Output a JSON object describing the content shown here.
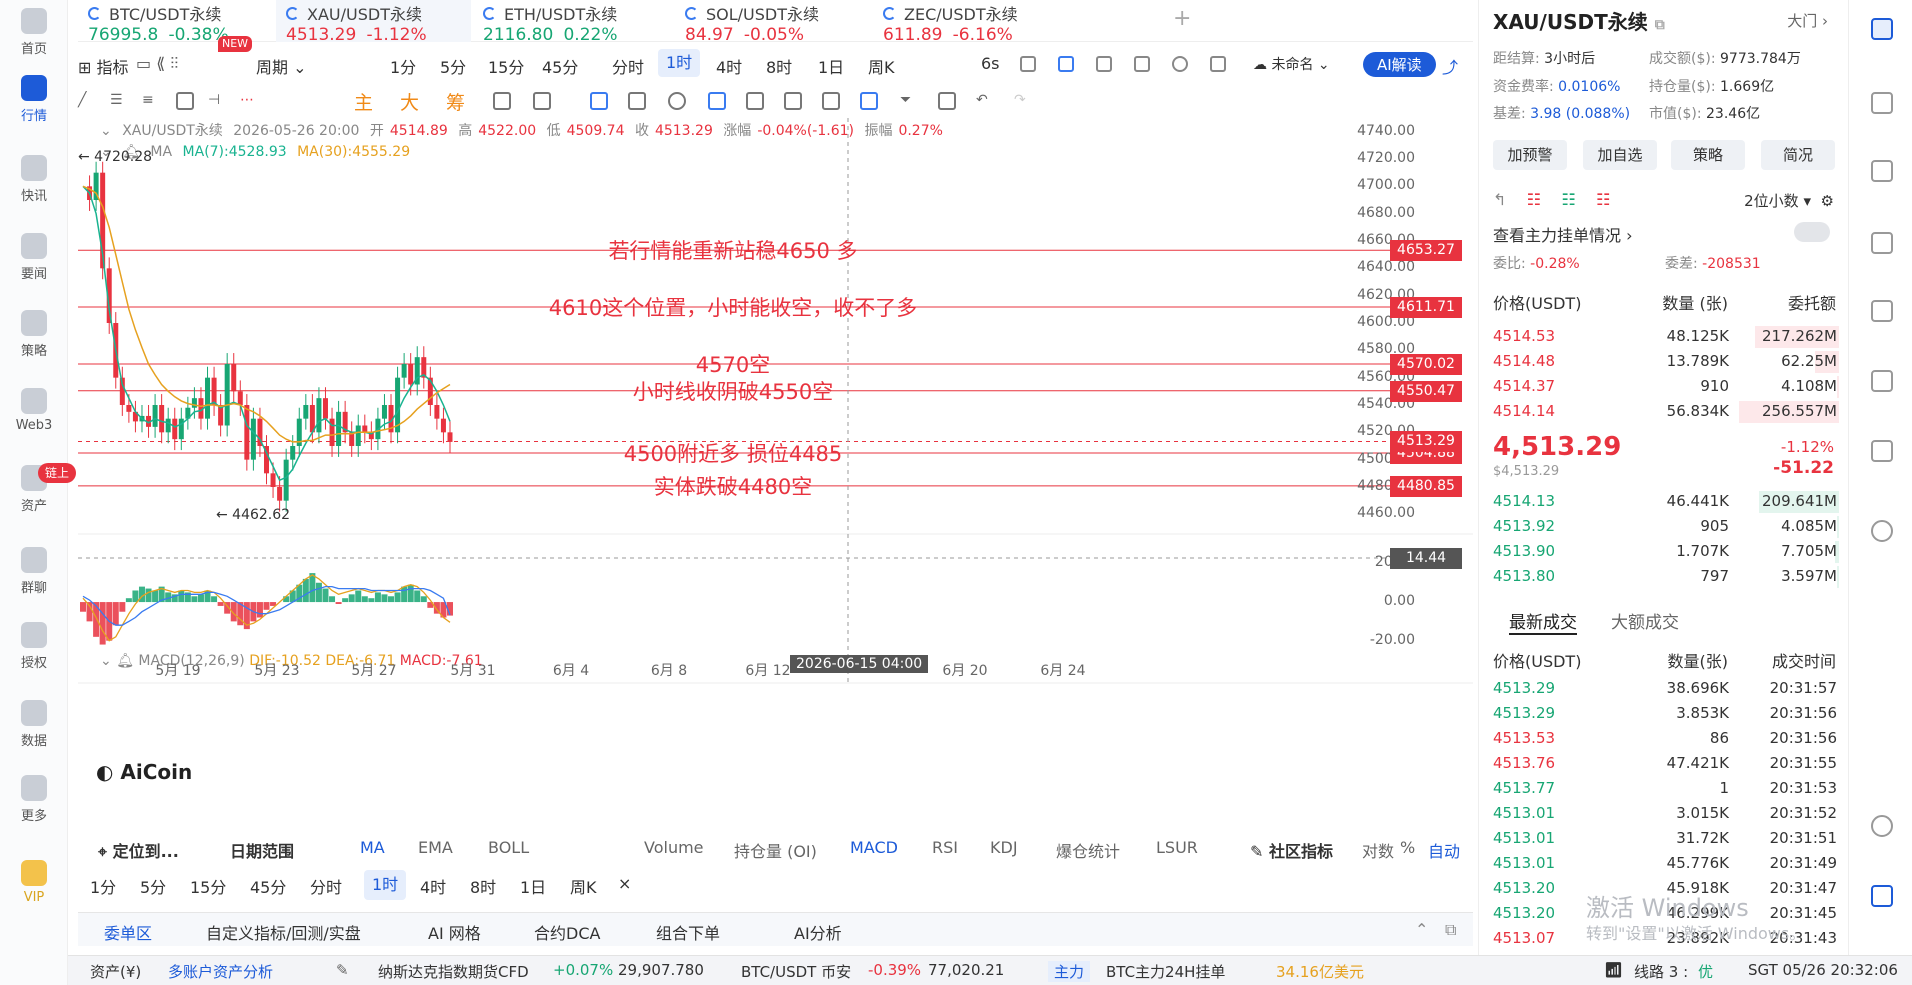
{
  "nav": [
    {
      "label": "首页",
      "icon": "home-icon"
    },
    {
      "label": "行情",
      "icon": "market-chart-icon",
      "active": true
    },
    {
      "label": "快讯",
      "icon": "news-flash-icon"
    },
    {
      "label": "要闻",
      "icon": "headline-icon"
    },
    {
      "label": "策略",
      "icon": "strategy-icon"
    },
    {
      "label": "Web3",
      "icon": "web3-icon"
    },
    {
      "label": "资产",
      "icon": "wallet-icon"
    },
    {
      "label": "群聊",
      "icon": "chat-icon"
    },
    {
      "label": "授权",
      "icon": "authorize-icon"
    },
    {
      "label": "数据",
      "icon": "data-icon"
    },
    {
      "label": "更多",
      "icon": "more-icon"
    },
    {
      "label": "VIP",
      "icon": "vip-icon"
    }
  ],
  "nav_badge": "链上",
  "tickers": [
    {
      "name": "BTC/USDT永续",
      "price": "76995.8",
      "change": "-0.38%",
      "color": "green"
    },
    {
      "name": "XAU/USDT永续",
      "price": "4513.29",
      "change": "-1.12%",
      "color": "red",
      "active": true
    },
    {
      "name": "ETH/USDT永续",
      "price": "2116.80",
      "change": "0.22%",
      "color": "green"
    },
    {
      "name": "SOL/USDT永续",
      "price": "84.97",
      "change": "-0.05%",
      "color": "red"
    },
    {
      "name": "ZEC/USDT永续",
      "price": "611.89",
      "change": "-6.16%",
      "color": "red"
    }
  ],
  "new_badge": "NEW",
  "plus_label": "+",
  "toolbar": {
    "indicator": "指标",
    "period": "周期",
    "periods": [
      "1分",
      "5分",
      "15分",
      "45分",
      "分时",
      "1时",
      "4时",
      "8时",
      "1日",
      "周K"
    ],
    "selected_period": "1时",
    "refresh": "6s",
    "layout_name": "未命名",
    "ai_button": "AI解读"
  },
  "drawing_tools": {
    "main": "主",
    "big": "大",
    "chip": "筹"
  },
  "legend": {
    "symbol": "XAU/USDT永续",
    "datetime": "2026-05-26 20:00",
    "open_label": "开",
    "open": "4514.89",
    "high_label": "高",
    "high": "4522.00",
    "low_label": "低",
    "low": "4509.74",
    "close_label": "收",
    "close": "4513.29",
    "change_label": "涨幅",
    "change": "-0.04%(-1.61)",
    "amp_label": "振幅",
    "amp": "0.27%",
    "ma_label": "MA",
    "ma7": "MA(7):4528.93",
    "ma30": "MA(30):4555.29"
  },
  "macd_legend": {
    "name": "MACD(12,26,9)",
    "dif": "DIF:-10.52",
    "dea": "DEA:-6.71",
    "macd": "MACD:-7.61"
  },
  "logo": "AiCoin",
  "chart_data": {
    "type": "line",
    "title": "",
    "y_ticks": [
      "4740.00",
      "4720.00",
      "4700.00",
      "4680.00",
      "4660.00",
      "4640.00",
      "4620.00",
      "4600.00",
      "4580.00",
      "4560.00",
      "4540.00",
      "4520.00",
      "4500.00",
      "4480.00",
      "4460.00"
    ],
    "ylim": [
      4450,
      4750
    ],
    "macd_ticks": [
      "20.00",
      "0.00",
      "-20.00"
    ],
    "macd_lim": [
      -30,
      28
    ],
    "x_ticks": [
      "5月 19",
      "5月 23",
      "5月 27",
      "5月 31",
      "6月 4",
      "6月 8",
      "6月 12",
      "6月 20",
      "6月 24"
    ],
    "crosshair_time": "2026-06-15 04:00",
    "crosshair_value": "14.44",
    "high_marker": "4720.28",
    "low_marker": "4462.62",
    "price_levels": [
      {
        "value": 4653.27,
        "label": "4653.27",
        "note": "若行情能重新站稳4650 多"
      },
      {
        "value": 4611.71,
        "label": "4611.71",
        "note": "4610这个位置，小时能收空，收不了多"
      },
      {
        "value": 4570.02,
        "label": "4570.02",
        "note": "4570空"
      },
      {
        "value": 4550.47,
        "label": "4550.47",
        "note": "小时线收阴破4550空"
      },
      {
        "value": 4504.88,
        "label": "4504.88",
        "note": "4500附近多  损位4485"
      },
      {
        "value": 4480.85,
        "label": "4480.85",
        "note": "实体跌破4480空"
      }
    ],
    "current_price": {
      "value": 4513.29,
      "label": "4513.29"
    },
    "price_path": [
      4700,
      4690,
      4710,
      4640,
      4600,
      4560,
      4540,
      4535,
      4528,
      4532,
      4524,
      4540,
      4520,
      4530,
      4515,
      4530,
      4538,
      4545,
      4530,
      4560,
      4540,
      4525,
      4570,
      4550,
      4540,
      4500,
      4530,
      4510,
      4490,
      4480,
      4470,
      4500,
      4510,
      4530,
      4540,
      4520,
      4545,
      4530,
      4510,
      4535,
      4520,
      4510,
      4525,
      4520,
      4515,
      4530,
      4540,
      4520,
      4560,
      4570,
      4555,
      4575,
      4560,
      4540,
      4530,
      4520,
      4513
    ],
    "ma7_path": [
      4700,
      4695,
      4680,
      4650,
      4610,
      4580,
      4555,
      4545,
      4535,
      4530,
      4527,
      4530,
      4528,
      4527,
      4524,
      4526,
      4530,
      4535,
      4536,
      4540,
      4542,
      4538,
      4540,
      4542,
      4540,
      4525,
      4520,
      4515,
      4505,
      4495,
      4485,
      4487,
      4493,
      4503,
      4512,
      4520,
      4528,
      4530,
      4525,
      4525,
      4522,
      4520,
      4520,
      4520,
      4519,
      4522,
      4526,
      4528,
      4535,
      4545,
      4553,
      4560,
      4562,
      4558,
      4550,
      4540,
      4528
    ],
    "ma30_path": [
      4700,
      4698,
      4695,
      4685,
      4670,
      4650,
      4630,
      4610,
      4595,
      4582,
      4570,
      4562,
      4555,
      4550,
      4546,
      4543,
      4541,
      4540,
      4539,
      4540,
      4540,
      4539,
      4540,
      4541,
      4540,
      4537,
      4535,
      4532,
      4528,
      4523,
      4518,
      4515,
      4513,
      4513,
      4514,
      4514,
      4516,
      4518,
      4518,
      4519,
      4519,
      4519,
      4520,
      4520,
      4520,
      4521,
      4522,
      4523,
      4525,
      4528,
      4532,
      4537,
      4541,
      4545,
      4549,
      4552,
      4555
    ],
    "macd_hist": [
      -5,
      -10,
      -18,
      -22,
      -20,
      -12,
      -5,
      2,
      6,
      8,
      7,
      6,
      8,
      5,
      4,
      6,
      5,
      3,
      4,
      6,
      3,
      -2,
      -6,
      -10,
      -12,
      -14,
      -10,
      -8,
      -4,
      -2,
      0,
      3,
      6,
      9,
      12,
      15,
      10,
      7,
      3,
      -1,
      2,
      4,
      6,
      3,
      2,
      5,
      4,
      3,
      5,
      8,
      9,
      6,
      3,
      -3,
      -6,
      -8,
      -7
    ],
    "macd_dif": [
      2,
      -2,
      -8,
      -15,
      -20,
      -18,
      -12,
      -6,
      -1,
      3,
      5,
      6,
      7,
      6,
      5,
      6,
      6,
      5,
      5,
      6,
      5,
      2,
      -2,
      -6,
      -9,
      -12,
      -11,
      -9,
      -6,
      -3,
      0,
      3,
      6,
      9,
      12,
      14,
      12,
      9,
      6,
      4,
      5,
      6,
      7,
      6,
      5,
      6,
      6,
      5,
      6,
      8,
      9,
      8,
      5,
      1,
      -4,
      -8,
      -10.5
    ],
    "macd_dea": [
      3,
      1,
      -2,
      -6,
      -10,
      -12,
      -12,
      -10,
      -8,
      -5,
      -3,
      -1,
      1,
      2,
      3,
      4,
      4,
      4,
      4,
      5,
      5,
      4,
      3,
      1,
      -1,
      -3,
      -5,
      -6,
      -6,
      -5,
      -4,
      -2,
      0,
      2,
      4,
      6,
      7,
      8,
      8,
      7,
      7,
      7,
      7,
      7,
      6,
      6,
      6,
      6,
      6,
      6,
      7,
      7,
      7,
      6,
      4,
      2,
      -6.7
    ]
  },
  "indicator_bar": {
    "locate": "定位到...",
    "date_range": "日期范围",
    "main": [
      "MA",
      "EMA",
      "BOLL"
    ],
    "sub": [
      "Volume",
      "持仓量 (OI)",
      "MACD",
      "RSI",
      "KDJ",
      "爆仓统计",
      "LSUR"
    ],
    "community": "社区指标",
    "log": "对数",
    "pct": "%",
    "auto": "自动"
  },
  "period_bar": [
    "1分",
    "5分",
    "15分",
    "45分",
    "分时",
    "1时",
    "4时",
    "8时",
    "1日",
    "周K"
  ],
  "period_bar_close": "×",
  "bottom_tabs": [
    "委单区",
    "自定义指标/回测/实盘",
    "AI 网格",
    "合约DCA",
    "组合下单",
    "AI分析"
  ],
  "status": {
    "asset": "资产(¥)",
    "multi": "多账户资产分析",
    "nasdaq": "纳斯达克指数期货CFD",
    "nasdaq_chg": "+0.07%",
    "nasdaq_px": "29,907.780",
    "btc": "BTC/USDT 币安",
    "btc_chg": "-0.39%",
    "btc_px": "77,020.21",
    "main_tag": "主力",
    "btc_main": "BTC主力24H挂单",
    "btc_main_val": "34.16亿美元",
    "line": "线路 3 :",
    "line_state": "优",
    "clock": "SGT  05/26 20:32:06"
  },
  "panel": {
    "title": "XAU/USDT永续",
    "exchange": "大门",
    "settle_label": "距结算:",
    "settle": "3小时后",
    "turnover_label": "成交额($):",
    "turnover": "9773.784万",
    "funding_label": "资金费率:",
    "funding": "0.0106%",
    "oi_label": "持仓量($):",
    "oi": "1.669亿",
    "basis_label": "基差:",
    "basis": "3.98 (0.088%)",
    "mcap_label": "市值($):",
    "mcap": "23.46亿",
    "buttons": [
      "加预警",
      "加自选",
      "策略",
      "简况"
    ],
    "decimals": "2位小数",
    "main_orders": "查看主力挂单情况",
    "ratio_label": "委比:",
    "ratio": "-0.28%",
    "diff_label": "委差:",
    "diff": "-208531",
    "ob_headers": [
      "价格(USDT)",
      "数量 (张)",
      "委托额"
    ],
    "asks": [
      {
        "price": "4514.53",
        "qty": "48.125K",
        "amt": "217.262M",
        "depth": 0.42
      },
      {
        "price": "4514.48",
        "qty": "13.789K",
        "amt": "62.25M",
        "depth": 0.12
      },
      {
        "price": "4514.37",
        "qty": "910",
        "amt": "4.108M",
        "depth": 0.01
      },
      {
        "price": "4514.14",
        "qty": "56.834K",
        "amt": "256.557M",
        "depth": 0.5
      }
    ],
    "last_price": "4,513.29",
    "last_usd": "$4,513.29",
    "last_pct": "-1.12%",
    "last_chg": "-51.22",
    "bids": [
      {
        "price": "4514.13",
        "qty": "46.441K",
        "amt": "209.641M",
        "depth": 0.4
      },
      {
        "price": "4513.92",
        "qty": "905",
        "amt": "4.085M",
        "depth": 0.01
      },
      {
        "price": "4513.90",
        "qty": "1.707K",
        "amt": "7.705M",
        "depth": 0.02
      },
      {
        "price": "4513.80",
        "qty": "797",
        "amt": "3.597M",
        "depth": 0.01
      }
    ],
    "trade_tabs": [
      "最新成交",
      "大额成交"
    ],
    "trade_headers": [
      "价格(USDT)",
      "数量(张)",
      "成交时间"
    ],
    "trades": [
      {
        "price": "4513.29",
        "qty": "38.696K",
        "time": "20:31:57",
        "side": "green"
      },
      {
        "price": "4513.29",
        "qty": "3.853K",
        "time": "20:31:56",
        "side": "green"
      },
      {
        "price": "4513.53",
        "qty": "86",
        "time": "20:31:56",
        "side": "red"
      },
      {
        "price": "4513.76",
        "qty": "47.421K",
        "time": "20:31:55",
        "side": "red"
      },
      {
        "price": "4513.77",
        "qty": "1",
        "time": "20:31:53",
        "side": "green"
      },
      {
        "price": "4513.01",
        "qty": "3.015K",
        "time": "20:31:52",
        "side": "green"
      },
      {
        "price": "4513.01",
        "qty": "31.72K",
        "time": "20:31:51",
        "side": "green"
      },
      {
        "price": "4513.01",
        "qty": "45.776K",
        "time": "20:31:49",
        "side": "green"
      },
      {
        "price": "4513.20",
        "qty": "45.918K",
        "time": "20:31:47",
        "side": "green"
      },
      {
        "price": "4513.20",
        "qty": "46.299K",
        "time": "20:31:45",
        "side": "green"
      },
      {
        "price": "4513.07",
        "qty": "23.892K",
        "time": "20:31:43",
        "side": "red"
      }
    ]
  },
  "watermark": "激活 Windows",
  "watermark_sub": "转到\"设置\"以激活 Windows。",
  "colors": {
    "up": "#17a673",
    "down": "#e8333f",
    "accent": "#1d5bd8",
    "ma30": "#e6a11f",
    "ma7": "#19b390"
  }
}
